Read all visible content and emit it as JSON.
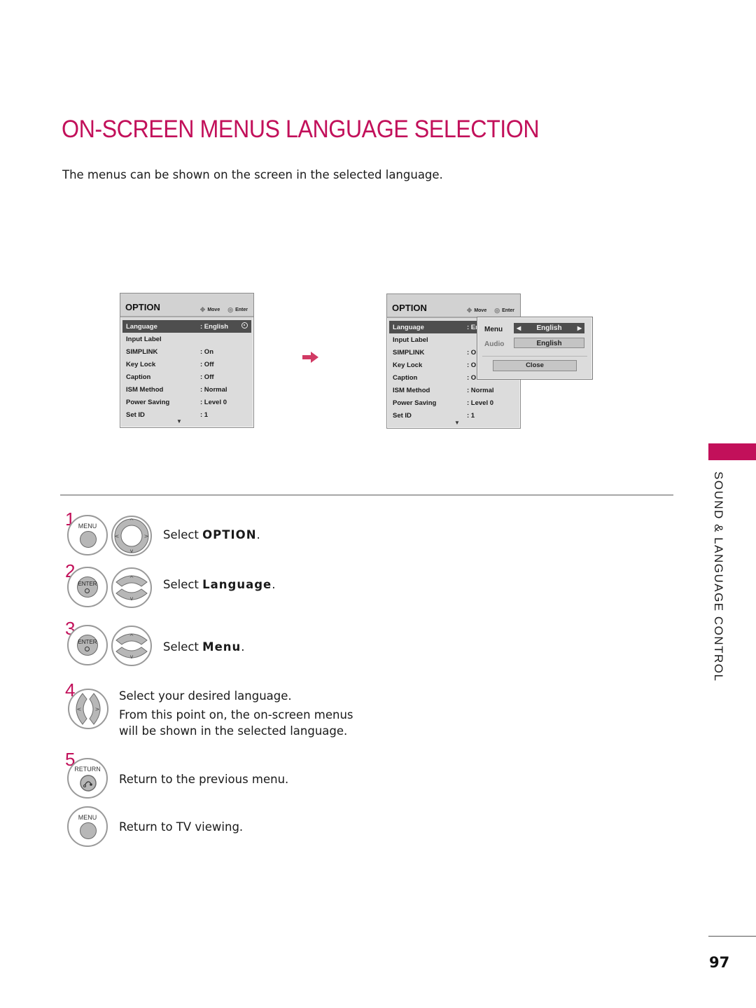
{
  "page": {
    "title": "ON-SCREEN MENUS LANGUAGE SELECTION",
    "intro": "The menus can be shown on the screen in the selected language.",
    "section": "SOUND & LANGUAGE CONTROL",
    "page_number": "97",
    "accent_color": "#c2105a"
  },
  "osd_before": {
    "title": "OPTION",
    "hint_move": "Move",
    "hint_enter": "Enter",
    "rows": [
      {
        "label": "Language",
        "value": ": English"
      },
      {
        "label": "Input Label",
        "value": ""
      },
      {
        "label": "SIMPLINK",
        "value": ": On"
      },
      {
        "label": "Key Lock",
        "value": ": Off"
      },
      {
        "label": "Caption",
        "value": ": Off"
      },
      {
        "label": "ISM Method",
        "value": ": Normal"
      },
      {
        "label": "Power Saving",
        "value": ": Level 0"
      },
      {
        "label": "Set ID",
        "value": ": 1"
      }
    ]
  },
  "osd_after": {
    "title": "OPTION",
    "hint_move": "Move",
    "hint_enter": "Enter",
    "rows": [
      {
        "label": "Language",
        "value": ": Er"
      },
      {
        "label": "Input Label",
        "value": ""
      },
      {
        "label": "SIMPLINK",
        "value": ": O"
      },
      {
        "label": "Key Lock",
        "value": ": O"
      },
      {
        "label": "Caption",
        "value": ": O"
      },
      {
        "label": "ISM Method",
        "value": ": Normal"
      },
      {
        "label": "Power Saving",
        "value": ": Level 0"
      },
      {
        "label": "Set ID",
        "value": ": 1"
      }
    ],
    "popup": {
      "menu_label": "Menu",
      "menu_value": "English",
      "audio_label": "Audio",
      "audio_value": "English",
      "close_label": "Close"
    }
  },
  "steps": [
    {
      "number": "1",
      "buttons": [
        "MENU"
      ],
      "text_prefix": "Select ",
      "text_bold": "OPTION",
      "text_suffix": "."
    },
    {
      "number": "2",
      "buttons": [
        "ENTER"
      ],
      "text_prefix": "Select ",
      "text_bold": "Language",
      "text_suffix": "."
    },
    {
      "number": "3",
      "buttons": [
        "ENTER"
      ],
      "text_prefix": "Select ",
      "text_bold": "Menu",
      "text_suffix": "."
    },
    {
      "number": "4",
      "buttons": [],
      "lines": [
        "Select your desired language.",
        "From this point on, the on-screen menus",
        "will be shown in the selected language."
      ]
    },
    {
      "number": "5",
      "buttons": [
        "RETURN"
      ],
      "text": "Return to the previous menu."
    },
    {
      "number": "",
      "buttons": [
        "MENU"
      ],
      "text": "Return to TV viewing."
    }
  ]
}
